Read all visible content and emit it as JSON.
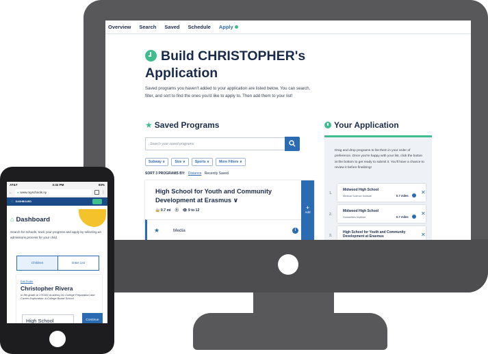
{
  "desktop": {
    "nav": [
      "Overview",
      "Search",
      "Saved",
      "Schedule",
      "Apply"
    ],
    "build": {
      "title": "Build CHRISTOPHER's Application",
      "description": "Saved programs you haven't added to your application are listed below. You can search, filter, and sort to find the ones you'd like to apply to. Then add them to your list!"
    },
    "saved": {
      "title": "Saved Programs",
      "search_placeholder": "Search your saved programs",
      "filters": [
        "Subway ∨",
        "Size ∨",
        "Sports ∨",
        "More Filters ∨"
      ],
      "sort_label": "SORT 3 PROGRAMS BY:",
      "sort_distance": "Distance",
      "sort_recent": "Recently Saved",
      "program": {
        "name": "High School for Youth and Community Development at Erasmus ∨",
        "distance": "0.7 mi",
        "grades": "9 to 12",
        "add_label": "Add",
        "media_label": "Media"
      }
    },
    "application": {
      "title": "Your Application",
      "description": "Drag and drop programs to list them in your order of preference. Once you're happy with your list, click the button at the bottom to get ready to submit it. You'll have a chance to review it before finalizing!",
      "items": [
        {
          "num": "1.",
          "name": "Midwood High School",
          "sub": "Medical Science Institute",
          "dist": "0.7 miles"
        },
        {
          "num": "2.",
          "name": "Midwood High School",
          "sub": "Humanities Institute",
          "dist": "0.7 miles"
        },
        {
          "num": "3.",
          "name": "High School for Youth and Community Development at Erasmus",
          "sub": "",
          "dist": ""
        }
      ]
    }
  },
  "phone": {
    "status": {
      "carrier": "AT&T",
      "time": "3:32 PM",
      "battery": "83%"
    },
    "url": "www.myschools.ny",
    "header_label": "DASHBOARD",
    "dashboard_title": "Dashboard",
    "dashboard_desc": "Search for schools, track your progress and apply by selecting an admissions process for your child.",
    "tabs": [
      "Children",
      "Date List"
    ],
    "child": {
      "edit": "Edit Profile",
      "name": "Christopher Rivera",
      "grade": "In 8th grade at 17K382 Academy for College Preparation and Career Exploration: A College Board School",
      "level": "High School",
      "continue": "Continue"
    }
  }
}
